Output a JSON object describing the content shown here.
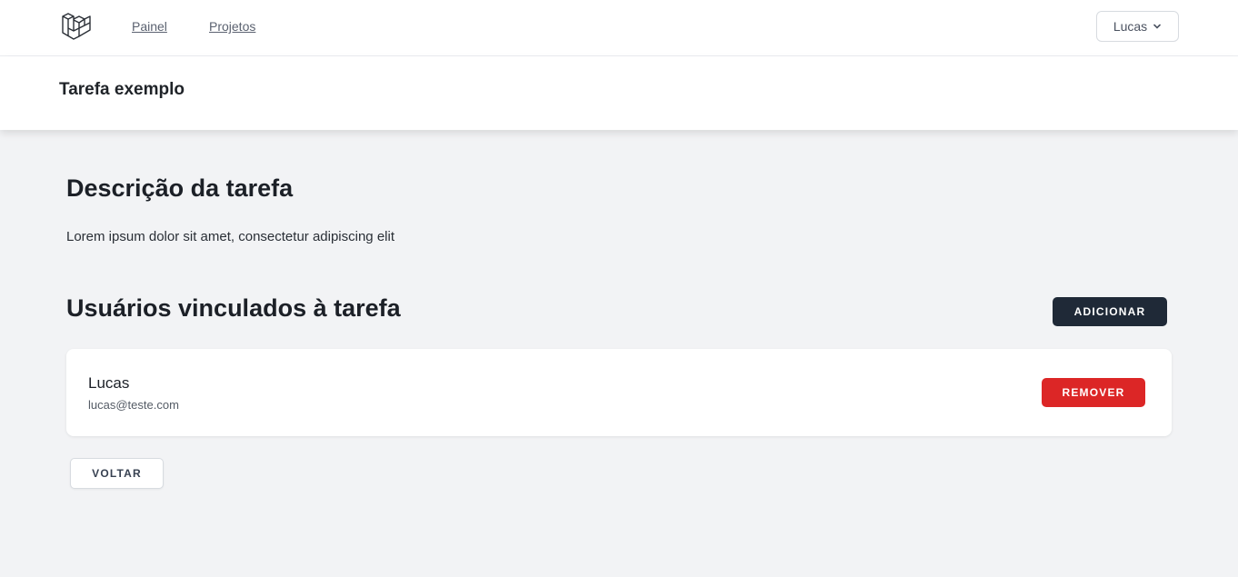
{
  "nav": {
    "logo_icon": "laravel-logo-icon",
    "links": [
      "Painel",
      "Projetos"
    ],
    "user_menu_label": "Lucas",
    "user_menu_icon": "chevron-down-icon"
  },
  "header": {
    "title": "Tarefa exemplo"
  },
  "description": {
    "title": "Descrição da tarefa",
    "text": "Lorem ipsum dolor sit amet, consectetur adipiscing elit"
  },
  "users": {
    "title": "Usuários vinculados à tarefa",
    "add_label": "ADICIONAR",
    "items": [
      {
        "name": "Lucas",
        "email": "lucas@teste.com",
        "remove_label": "REMOVER"
      }
    ]
  },
  "back_label": "VOLTAR",
  "colors": {
    "add_button": "#1f2937",
    "remove_button": "#dc2626",
    "page_background": "#f2f3f5"
  }
}
